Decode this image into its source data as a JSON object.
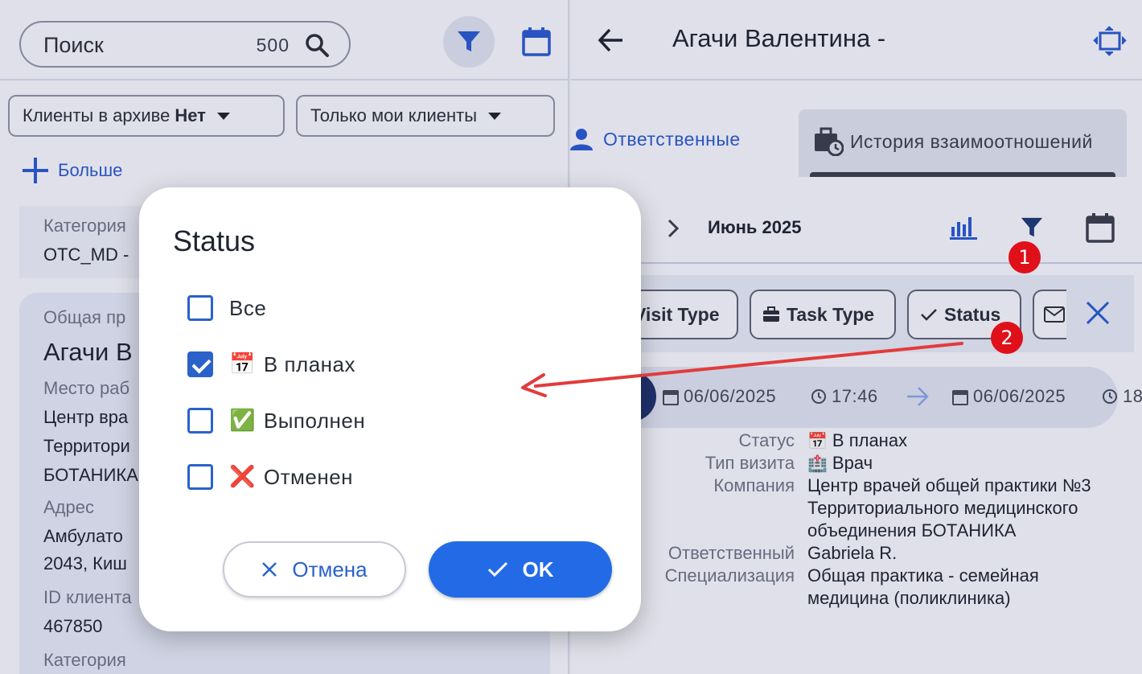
{
  "left": {
    "search_placeholder": "Поиск",
    "search_count": "500",
    "filter_archive_label": "Клиенты в архиве",
    "filter_archive_value": "Нет",
    "filter_mine_label": "Только мои клиенты",
    "more_label": "Больше",
    "category_label": "Категория",
    "category_value": "OTC_MD -",
    "card": {
      "group_label": "Общая пр",
      "name": "Агачи В",
      "workplace_label": "Место раб",
      "workplace_lines": [
        "Центр вра",
        "Территори",
        "БОТАНИКА"
      ],
      "address_label": "Адрес",
      "address_lines": [
        "Амбулато",
        "2043, Киш"
      ],
      "client_id_label": "ID клиента",
      "client_id": "467850",
      "category_label": "Категория"
    }
  },
  "right": {
    "title": "Агачи Валентина -",
    "tab_responsible": "Ответственные",
    "tab_history": "История взаимоотношений",
    "month": "Июнь 2025",
    "chips": {
      "visit_type": "Visit Type",
      "task_type": "Task Type",
      "status": "Status"
    },
    "visit": {
      "date_from": "06/06/2025",
      "time_from": "17:46",
      "date_to": "06/06/2025",
      "time_to": "18"
    },
    "details": [
      {
        "key": "Статус",
        "emoji": "📅",
        "value": "В планах"
      },
      {
        "key": "Тип визита",
        "emoji": "🏥",
        "value": "Врач"
      },
      {
        "key": "Компания",
        "emoji": "",
        "value": "Центр врачей общей практики №3 Территориального медицинского объединения БОТАНИКА"
      },
      {
        "key": "Ответственный",
        "emoji": "",
        "value": "Gabriela R."
      },
      {
        "key": "Специализация",
        "emoji": "",
        "value": "Общая практика - семейная медицина (поликлиника)"
      }
    ]
  },
  "dialog": {
    "title": "Status",
    "options": [
      {
        "label": "Все",
        "emoji": "",
        "checked": false
      },
      {
        "label": "В планах",
        "emoji": "📅",
        "checked": true
      },
      {
        "label": "Выполнен",
        "emoji": "✅",
        "checked": false
      },
      {
        "label": "Отменен",
        "emoji": "❌",
        "checked": false
      }
    ],
    "cancel_label": "Отмена",
    "ok_label": "OK"
  },
  "annotations": {
    "badge_1": "1",
    "badge_2": "2",
    "arrow_color": "#e23b3b"
  },
  "colors": {
    "accent": "#236be6",
    "link": "#2a5bd0",
    "badge": "#e0101a"
  }
}
